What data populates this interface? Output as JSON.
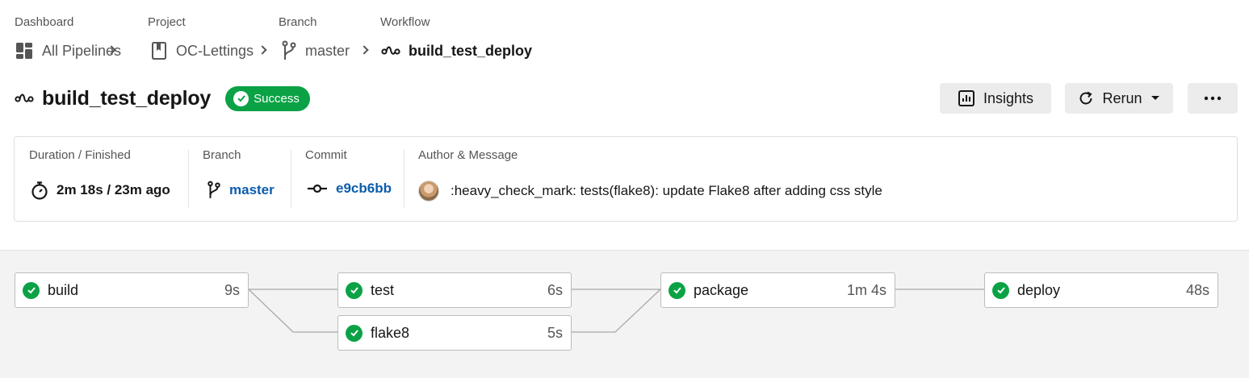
{
  "breadcrumb": {
    "items": [
      {
        "label": "Dashboard",
        "link": "All Pipelines",
        "icon": "dashboard-icon"
      },
      {
        "label": "Project",
        "link": "OC-Lettings",
        "icon": "project-bookmark-icon"
      },
      {
        "label": "Branch",
        "link": "master",
        "icon": "branch-icon"
      },
      {
        "label": "Workflow",
        "link": "build_test_deploy",
        "icon": "workflow-icon"
      }
    ]
  },
  "header": {
    "title": "build_test_deploy",
    "status": "Success",
    "insights_label": "Insights",
    "rerun_label": "Rerun"
  },
  "summary": {
    "duration_label": "Duration / Finished",
    "duration_value": "2m 18s / 23m ago",
    "branch_label": "Branch",
    "branch_value": "master",
    "commit_label": "Commit",
    "commit_value": "e9cb6bb",
    "author_label": "Author & Message",
    "message": ":heavy_check_mark: tests(flake8): update Flake8 after adding css style"
  },
  "jobs": [
    {
      "name": "build",
      "duration": "9s",
      "status": "success"
    },
    {
      "name": "test",
      "duration": "6s",
      "status": "success"
    },
    {
      "name": "flake8",
      "duration": "5s",
      "status": "success"
    },
    {
      "name": "package",
      "duration": "1m 4s",
      "status": "success"
    },
    {
      "name": "deploy",
      "duration": "48s",
      "status": "success"
    }
  ],
  "colors": {
    "success": "#0aa245",
    "link": "#0b5cad"
  }
}
